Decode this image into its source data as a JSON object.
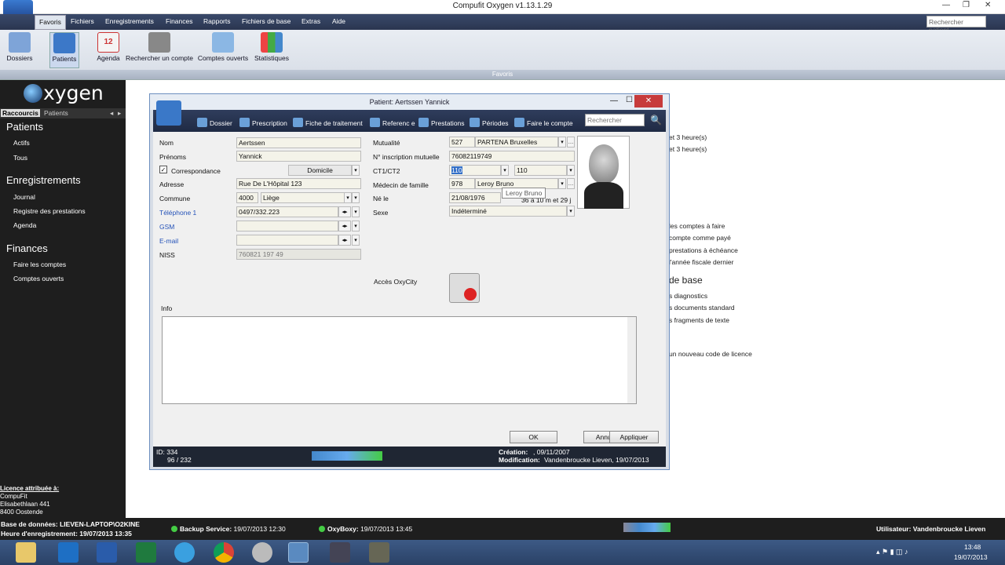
{
  "window": {
    "title": "Compufit Oxygen v1.13.1.29"
  },
  "menu": {
    "items": [
      "Favoris",
      "Fichiers",
      "Enregistrements",
      "Finances",
      "Rapports",
      "Fichiers de base",
      "Extras",
      "Aide"
    ],
    "search_placeholder": "Rechercher patient"
  },
  "ribbon": {
    "buttons": [
      "Dossiers",
      "Patients",
      "Agenda",
      "Rechercher un compte",
      "Comptes ouverts",
      "Statistiques"
    ],
    "group_label": "Favoris",
    "agenda_day": "12"
  },
  "sidebar": {
    "logo": "xygen",
    "tabs": [
      "Raccourcis",
      "Patients"
    ],
    "sections": [
      {
        "title": "Patients",
        "items": [
          "Actifs",
          "Tous"
        ]
      },
      {
        "title": "Enregistrements",
        "items": [
          "Journal",
          "Registre des prestations",
          "Agenda"
        ]
      },
      {
        "title": "Finances",
        "items": [
          "Faire les comptes",
          "Comptes ouverts"
        ]
      }
    ],
    "licence": {
      "heading": "Licence attribuée à:",
      "lines": [
        "CompuFit",
        "Elisabethlaan 441",
        "8400  Oostende"
      ]
    }
  },
  "background": {
    "lines": [
      "et 3 heure(s)",
      "et 3 heure(s)",
      "les comptes à faire",
      "compte comme payé",
      "prestations à échéance",
      "l'année fiscale dernier",
      "de base",
      "s diagnostics",
      "s documents standard",
      "s fragments de texte",
      "un nouveau code de licence"
    ]
  },
  "dialog": {
    "title": "Patient: Aertssen Yannick",
    "toolbar": [
      "Dossier",
      "Prescription",
      "Fiche de traitement",
      "Referenc e",
      "Prestations",
      "Périodes",
      "Faire le compte"
    ],
    "toolbar_search": "Rechercher",
    "fields": {
      "nom_label": "Nom",
      "nom": "Aertssen",
      "prenoms_label": "Prénoms",
      "prenoms": "Yannick",
      "correspondance": "Correspondance",
      "domicile": "Domicile",
      "adresse_label": "Adresse",
      "adresse": "Rue De L'Hôpital 123",
      "commune_label": "Commune",
      "cp": "4000",
      "commune": "Liège",
      "tel_label": "Téléphone 1",
      "tel": "0497/332.223",
      "gsm_label": "GSM",
      "email_label": "E-mail",
      "niss_label": "NISS",
      "niss": "760821 197 49",
      "mutualite_label": "Mutualité",
      "mut_code": "527",
      "mutualite": "PARTENA Bruxelles",
      "inscr_label": "N° inscription mutuelle",
      "inscr": "76082119749",
      "ct_label": "CT1/CT2",
      "ct1": "110",
      "ct2": "110",
      "medecin_label": "Médecin de famille",
      "med_code": "978",
      "medecin": "Leroy Bruno",
      "tooltip": "Leroy Bruno",
      "ne_label": "Né le",
      "ne": "21/08/1976",
      "age": "36 a 10 m et 29 j",
      "sexe_label": "Sexe",
      "sexe": "Indéterminé",
      "oxy_label": "Accès OxyCity",
      "info_label": "Info"
    },
    "buttons": {
      "ok": "OK",
      "annuler": "Annuler",
      "appliquer": "Appliquer"
    },
    "status": {
      "id": "ID:  334",
      "count": "96 / 232",
      "creation_label": "Création:",
      "creation": ", 09/11/2007",
      "modification_label": "Modification:",
      "modification": "Vandenbroucke Lieven, 19/07/2013"
    }
  },
  "statusbar": {
    "db": "Base de données: LIEVEN-LAPTOP\\O2KINE",
    "heure": "Heure d'enregistrement: 19/07/2013 13:35",
    "backup_label": "Backup Service:",
    "backup": "19/07/2013 12:30",
    "oxyboxy_label": "OxyBoxy:",
    "oxyboxy": "19/07/2013 13:45",
    "user": "Utilisateur: Vandenbroucke Lieven"
  },
  "taskbar": {
    "time": "13:48",
    "date": "19/07/2013"
  }
}
